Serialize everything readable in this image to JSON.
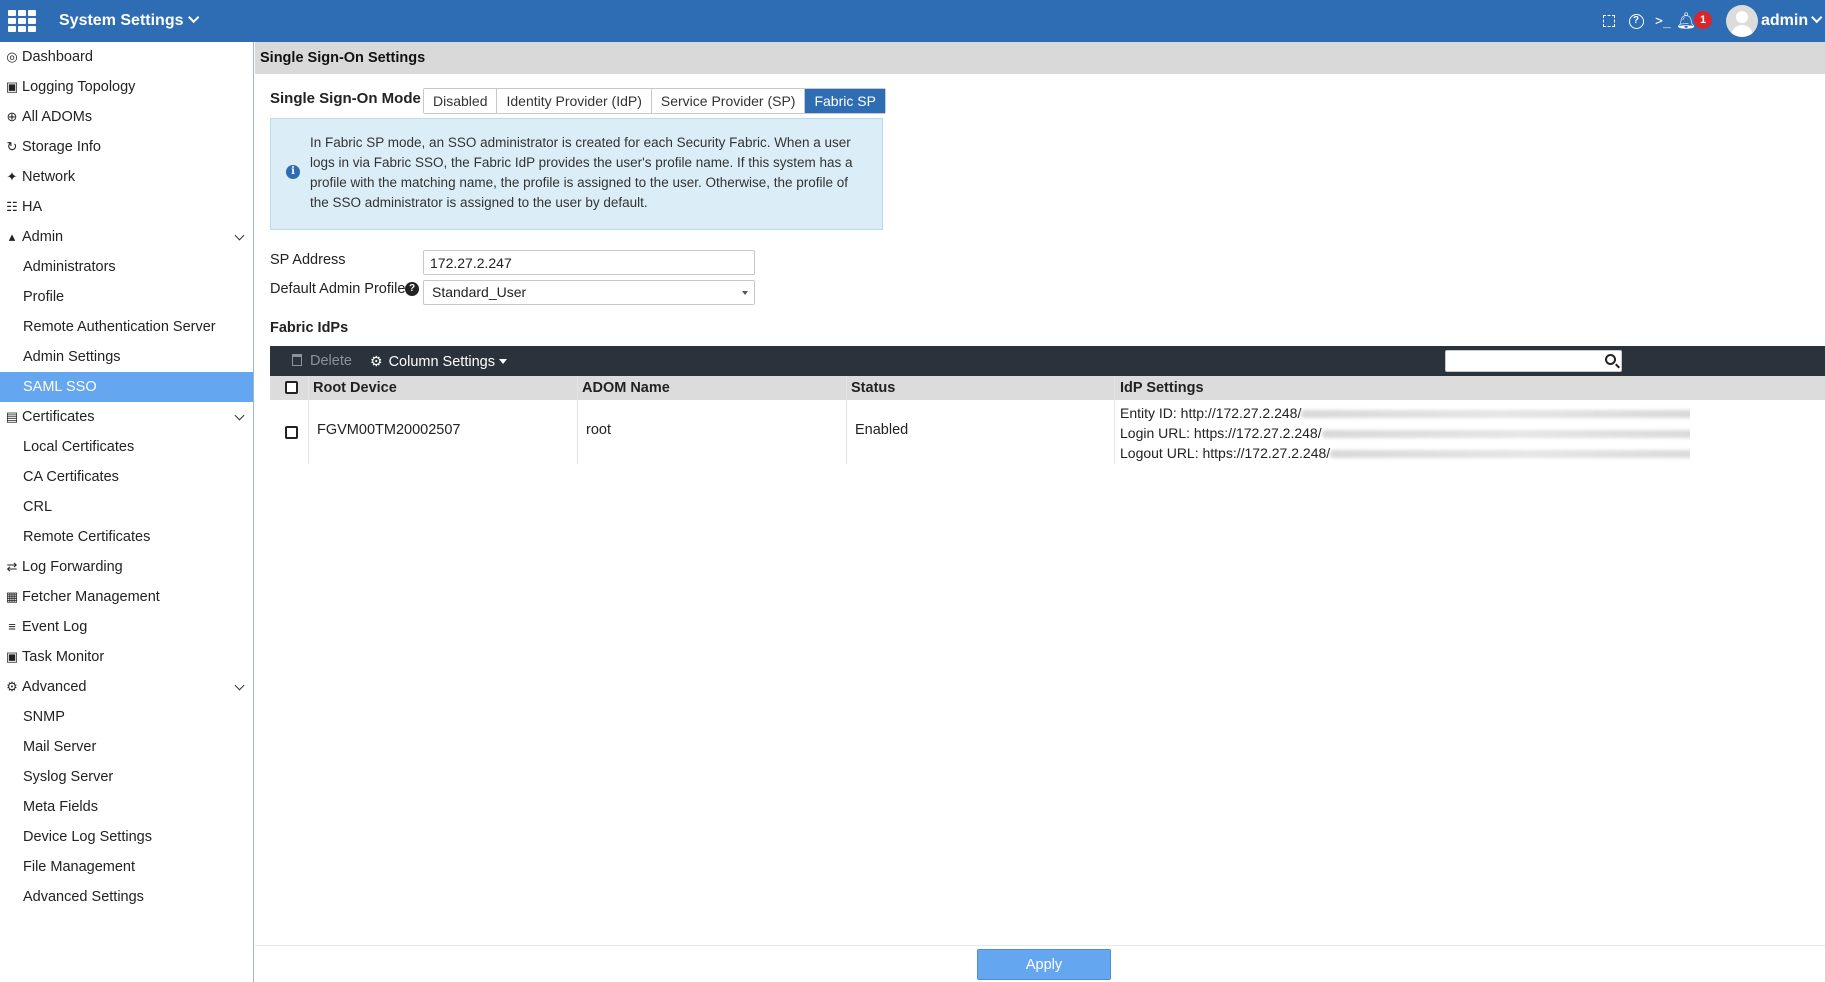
{
  "topbar": {
    "title": "System Settings",
    "notification_count": "1",
    "user": "admin",
    "icons": [
      "grid-menu-icon",
      "expand-icon",
      "help-icon",
      "cli-console-icon",
      "bell-icon",
      "avatar-icon"
    ],
    "brand_color": "#2e6db3"
  },
  "sidebar": {
    "items": [
      {
        "label": "Dashboard",
        "level": "top",
        "icon": "dashboard-icon"
      },
      {
        "label": "Logging Topology",
        "level": "top",
        "icon": "topology-icon"
      },
      {
        "label": "All ADOMs",
        "level": "top",
        "icon": "globe-icon"
      },
      {
        "label": "Storage Info",
        "level": "top",
        "icon": "storage-icon"
      },
      {
        "label": "Network",
        "level": "top",
        "icon": "network-icon"
      },
      {
        "label": "HA",
        "level": "top",
        "icon": "ha-icon"
      },
      {
        "label": "Admin",
        "level": "top",
        "icon": "user-icon",
        "expandable": true
      },
      {
        "label": "Administrators",
        "level": "sub"
      },
      {
        "label": "Profile",
        "level": "sub"
      },
      {
        "label": "Remote Authentication Server",
        "level": "sub"
      },
      {
        "label": "Admin Settings",
        "level": "sub"
      },
      {
        "label": "SAML SSO",
        "level": "sub",
        "active": true
      },
      {
        "label": "Certificates",
        "level": "top",
        "icon": "certificate-icon",
        "expandable": true
      },
      {
        "label": "Local Certificates",
        "level": "sub"
      },
      {
        "label": "CA Certificates",
        "level": "sub"
      },
      {
        "label": "CRL",
        "level": "sub"
      },
      {
        "label": "Remote Certificates",
        "level": "sub"
      },
      {
        "label": "Log Forwarding",
        "level": "top",
        "icon": "forwarding-icon"
      },
      {
        "label": "Fetcher Management",
        "level": "top",
        "icon": "fetcher-icon"
      },
      {
        "label": "Event Log",
        "level": "top",
        "icon": "event-log-icon"
      },
      {
        "label": "Task Monitor",
        "level": "top",
        "icon": "task-monitor-icon"
      },
      {
        "label": "Advanced",
        "level": "top",
        "icon": "advanced-icon",
        "expandable": true
      },
      {
        "label": "SNMP",
        "level": "sub"
      },
      {
        "label": "Mail Server",
        "level": "sub"
      },
      {
        "label": "Syslog Server",
        "level": "sub"
      },
      {
        "label": "Meta Fields",
        "level": "sub"
      },
      {
        "label": "Device Log Settings",
        "level": "sub"
      },
      {
        "label": "File Management",
        "level": "sub"
      },
      {
        "label": "Advanced Settings",
        "level": "sub"
      }
    ],
    "active_color": "#64a7f0"
  },
  "main": {
    "section_title": "Single Sign-On Settings",
    "sso_mode_label": "Single Sign-On Mode",
    "modes": [
      "Disabled",
      "Identity Provider (IdP)",
      "Service Provider (SP)",
      "Fabric SP"
    ],
    "selected_mode": "Fabric SP",
    "info_text": "In Fabric SP mode, an SSO administrator is created for each Security Fabric. When a user logs in via Fabric SSO, the Fabric IdP provides the user's profile name. If this system has a profile with the matching name, the profile is assigned to the user. Otherwise, the profile of the SSO administrator is assigned to the user by default.",
    "sp_address_label": "SP Address",
    "sp_address_value": "172.27.2.247",
    "default_profile_label": "Default Admin Profile",
    "default_profile_value": "Standard_User",
    "fabric_idps_label": "Fabric IdPs",
    "toolbar": {
      "delete_label": "Delete",
      "column_settings_label": "Column Settings",
      "search_placeholder": ""
    },
    "table": {
      "columns": [
        "Root Device",
        "ADOM Name",
        "Status",
        "IdP Settings"
      ],
      "rows": [
        {
          "root_device": "FGVM00TM20002507",
          "adom_name": "root",
          "status": "Enabled",
          "entity_id": "Entity ID: http://172.27.2.248/",
          "login_url": "Login URL: https://172.27.2.248/",
          "logout_url": "Logout URL: https://172.27.2.248/"
        }
      ]
    },
    "apply_label": "Apply"
  }
}
